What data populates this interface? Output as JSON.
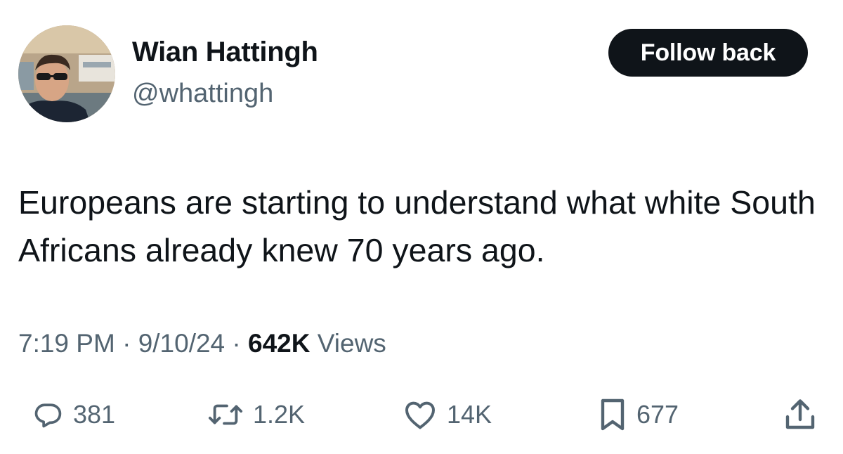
{
  "author": {
    "display_name": "Wian Hattingh",
    "handle": "@whattingh"
  },
  "follow_button_label": "Follow back",
  "tweet": {
    "text": "Europeans are starting to understand what white South Africans already knew 70 years ago."
  },
  "meta": {
    "time": "7:19 PM",
    "separator": "·",
    "date": "9/10/24",
    "views_count": "642K",
    "views_label": "Views"
  },
  "actions": {
    "replies": "381",
    "reposts": "1.2K",
    "likes": "14K",
    "bookmarks": "677"
  },
  "icons": {
    "reply": "reply-icon",
    "repost": "repost-icon",
    "like": "heart-icon",
    "bookmark": "bookmark-icon",
    "share": "share-icon"
  },
  "colors": {
    "text_primary": "#0f1419",
    "text_secondary": "#536471",
    "button_bg": "#0f1419",
    "button_text": "#ffffff"
  }
}
